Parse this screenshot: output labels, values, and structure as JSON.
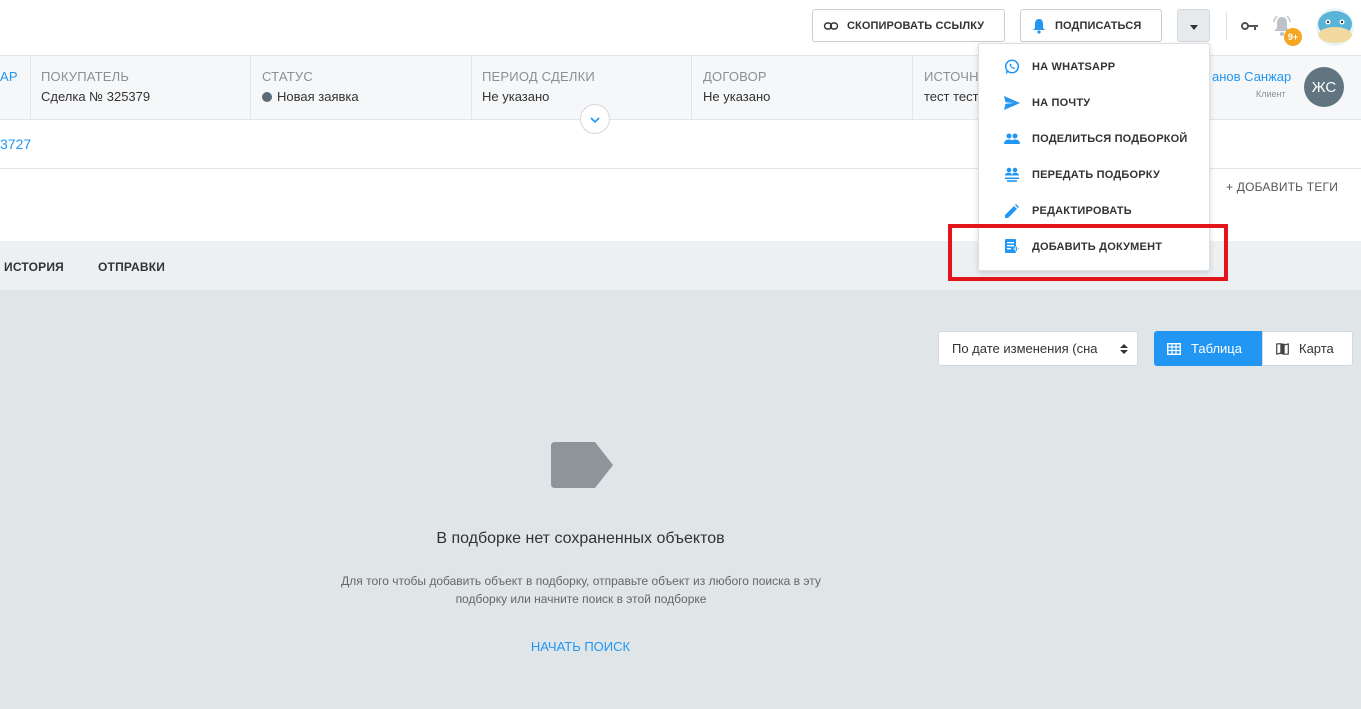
{
  "header": {
    "copy_link_label": "СКОПИРОВАТЬ ССЫЛКУ",
    "subscribe_label": "ПОДПИСАТЬСЯ",
    "notifications_badge": "9+"
  },
  "deal": {
    "first_col_fragment": "ар",
    "buyer_label": "ПОКУПАТЕЛЬ",
    "buyer_value": "Сделка № 325379",
    "status_label": "СТАТУС",
    "status_value": "Новая заявка",
    "period_label": "ПЕРИОД СДЕЛКИ",
    "period_value": "Не указано",
    "contract_label": "ДОГОВОР",
    "contract_value": "Не указано",
    "source_label": "ИСТОЧН",
    "source_value": "тест тест",
    "owner_name": "анов Санжар",
    "owner_role": "Клиент",
    "owner_initials": "ЖС",
    "id_fragment": "3727",
    "add_tags_label": "+ ДОБАВИТЬ ТЕГИ"
  },
  "tabs": {
    "history": "ИСТОРИЯ",
    "sends": "ОТПРАВКИ"
  },
  "toolbar": {
    "sort_value": "По дате изменения (сна",
    "view_table_label": "Таблица",
    "view_map_label": "Карта"
  },
  "empty_state": {
    "title": "В подборке нет сохраненных объектов",
    "description": "Для того чтобы добавить объект в подборку, отправьте объект из любого поиска в эту подборку или начните поиск в этой подборке",
    "action_label": "НАЧАТЬ ПОИСК"
  },
  "dropdown": {
    "items": [
      {
        "label": "НА WHATSAPP",
        "icon": "whatsapp-icon"
      },
      {
        "label": "НА ПОЧТУ",
        "icon": "send-icon"
      },
      {
        "label": "ПОДЕЛИТЬСЯ ПОДБОРКОЙ",
        "icon": "people-icon"
      },
      {
        "label": "ПЕРЕДАТЬ ПОДБОРКУ",
        "icon": "people-transfer-icon"
      },
      {
        "label": "РЕДАКТИРОВАТЬ",
        "icon": "pencil-icon"
      },
      {
        "label": "ДОБАВИТЬ ДОКУМЕНТ",
        "icon": "add-document-icon"
      }
    ]
  },
  "colors": {
    "accent": "#2196f3",
    "highlight": "#e4141b",
    "badge": "#f5a623"
  }
}
